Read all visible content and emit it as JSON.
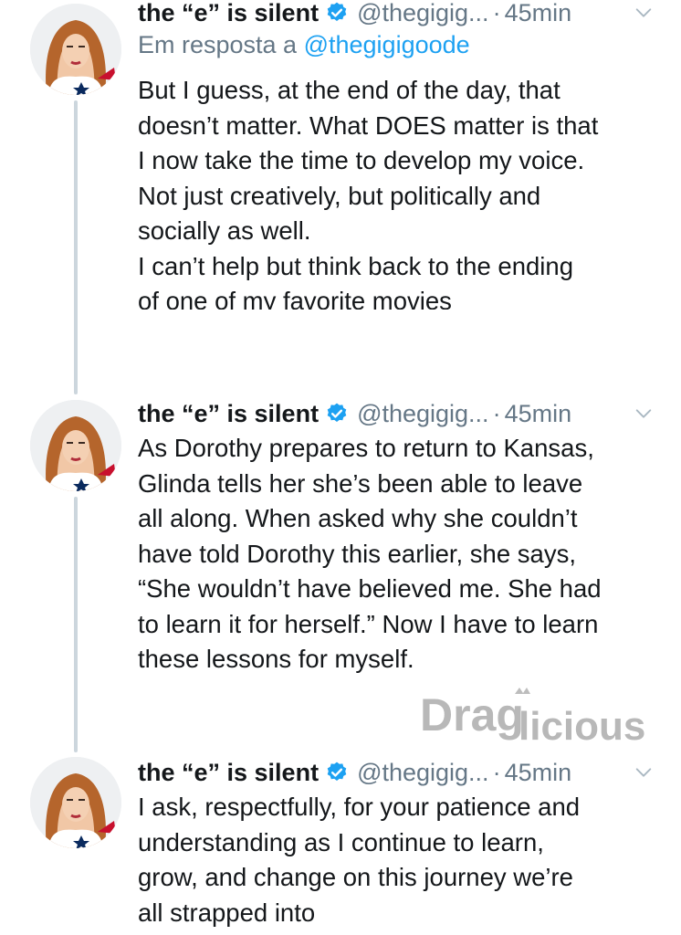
{
  "watermark": {
    "text_left": "Drag",
    "text_right": "licious"
  },
  "tweets": [
    {
      "display_name": "the “e” is silent",
      "handle": "@thegigig...",
      "dot": "·",
      "time": "45min",
      "reply_label": "Em resposta a",
      "reply_mention": "@thegigigoode",
      "lines": [
        "But I guess, at the end of the day, that",
        "doesn’t matter. What DOES matter is that",
        "I now take the time to develop my voice.",
        "Not just creatively, but politically and",
        "socially as well.",
        "I can’t help but think back to the ending",
        "of one of my favorite movies"
      ]
    },
    {
      "display_name": "the “e” is silent",
      "handle": "@thegigig...",
      "dot": "·",
      "time": "45min",
      "lines": [
        "As Dorothy prepares to return to Kansas,",
        "Glinda tells her she’s been able to leave",
        "all along. When asked why she couldn’t",
        "have told Dorothy this earlier, she says,",
        "“She wouldn’t have believed me. She had",
        "to learn it for herself.” Now I have to learn",
        "these lessons for myself."
      ]
    },
    {
      "display_name": "the “e” is silent",
      "handle": "@thegigig...",
      "dot": "·",
      "time": "45min",
      "lines": [
        "I ask, respectfully, for your patience and",
        "understanding as I continue to learn,",
        "grow, and change on this journey we’re",
        "all strapped into"
      ]
    }
  ]
}
